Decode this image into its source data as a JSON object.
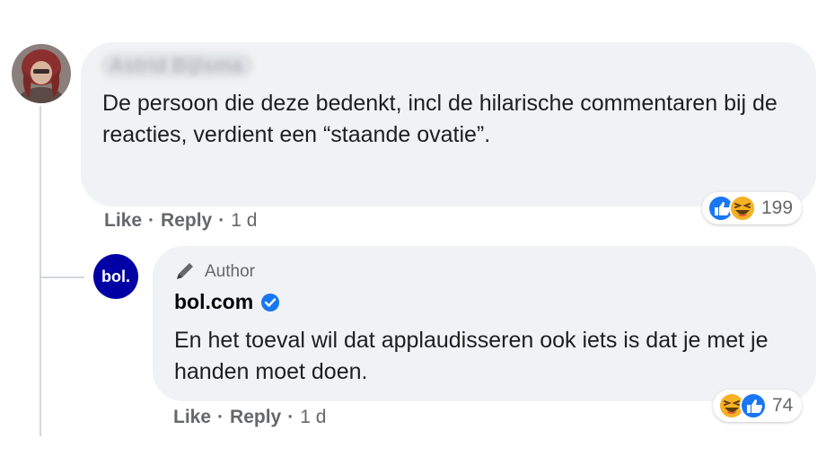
{
  "comment": {
    "author_name": "Astrid Bijlsma",
    "text": "De persoon die deze bedenkt, incl de hilarische commentaren bij de reacties, verdient een “staande ovatie”.",
    "actions": {
      "like": "Like",
      "reply": "Reply",
      "age": "1 d"
    },
    "reactions": {
      "icons": [
        "like-icon",
        "haha-icon"
      ],
      "count": "199"
    }
  },
  "reply": {
    "badge": "Author",
    "badge_icon": "pen-icon",
    "page_name": "bol.com",
    "verified_icon": "verified-badge-icon",
    "avatar_text": "bol.",
    "text": "En het toeval wil dat applaudisseren ook iets is dat je met je handen moet doen.",
    "actions": {
      "like": "Like",
      "reply": "Reply",
      "age": "1 d"
    },
    "reactions": {
      "icons": [
        "haha-icon",
        "like-icon"
      ],
      "count": "74"
    }
  },
  "colors": {
    "bubble": "#f0f2f5",
    "facebook_blue": "#1877f2",
    "bol_navy": "#0000a4",
    "haha_yellow": "#f7b125",
    "meta_text": "#65676b"
  }
}
